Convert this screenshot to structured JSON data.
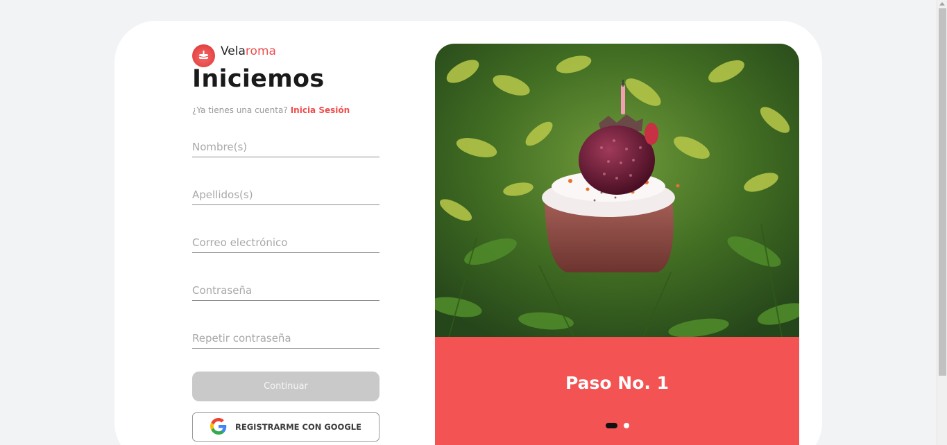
{
  "brand": {
    "name_part1": "Vela",
    "name_part2": "roma"
  },
  "signup": {
    "title": "Iniciemos",
    "have_account_text": "¿Ya tienes una cuenta?",
    "login_link": "Inicia Sesión",
    "fields": {
      "first_name_placeholder": "Nombre(s)",
      "last_name_placeholder": "Apellidos(s)",
      "email_placeholder": "Correo electrónico",
      "password_placeholder": "Contraseña",
      "repeat_password_placeholder": "Repetir contraseña"
    },
    "continue_label": "Continuar",
    "google_label": "REGISTRARME CON GOOGLE"
  },
  "carousel": {
    "step_title": "Paso No. 1",
    "slide_count": 2,
    "active_slide": 1,
    "photo_icon": "strawberry-cupcake-candle-photo"
  },
  "colors": {
    "accent": "#f45353",
    "button_disabled": "#c9c9c9",
    "background": "#f2f3f5"
  }
}
